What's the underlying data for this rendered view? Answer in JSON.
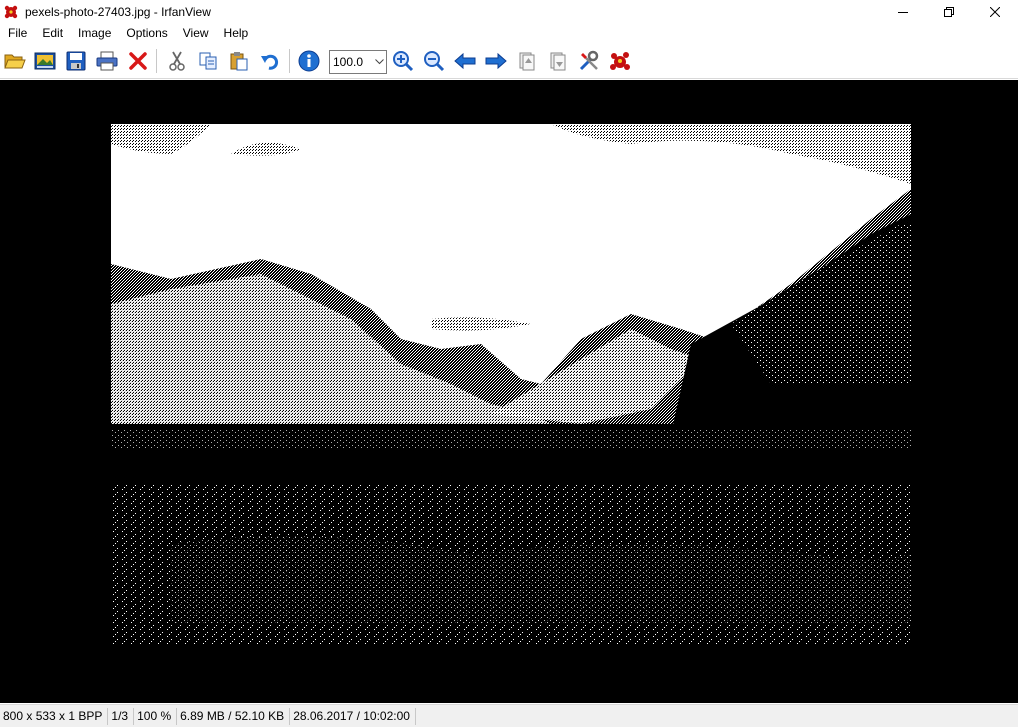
{
  "window": {
    "title": "pexels-photo-27403.jpg - IrfanView"
  },
  "menu": [
    "File",
    "Edit",
    "Image",
    "Options",
    "View",
    "Help"
  ],
  "toolbar": {
    "zoom_value": "100.0"
  },
  "status": {
    "dimensions": "800 x 533 x 1 BPP",
    "index": "1/3",
    "zoom": "100 %",
    "size": "6.89 MB / 52.10 KB",
    "datetime": "28.06.2017 / 10:02:00"
  },
  "colors": {
    "icon_blue": "#1f6fd1",
    "icon_red": "#d81818",
    "icon_yellow": "#f2c02e",
    "viewer_bg": "#000000"
  }
}
